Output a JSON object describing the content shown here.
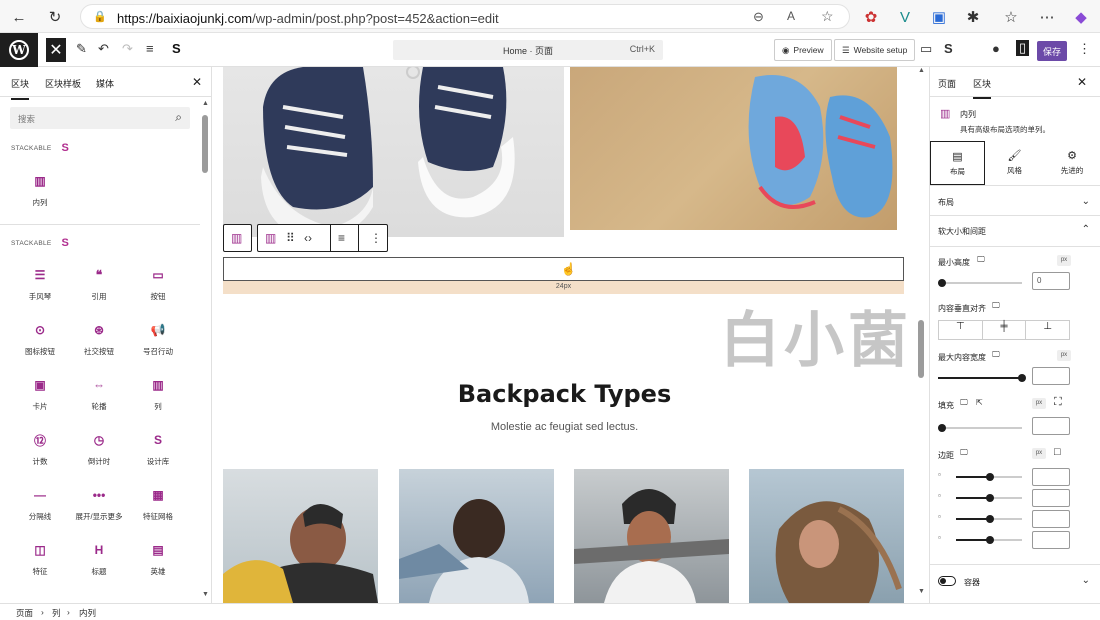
{
  "browser": {
    "url_host": "https://baixiaojunkj.com",
    "url_path": "/wp-admin/post.php?post=452&action=edit"
  },
  "wp_top": {
    "command_label": "Home · 页面",
    "command_shortcut": "Ctrl+K",
    "preview_label": "Preview",
    "website_setup_label": "Website setup",
    "save_label": "保存"
  },
  "left_panel": {
    "tabs": [
      "区块",
      "区块样板",
      "媒体"
    ],
    "search_placeholder": "搜索",
    "category1": "STACKABLE",
    "category1_blocks": [
      {
        "label": "内列",
        "icon": "columns-icon"
      }
    ],
    "category2": "STACKABLE",
    "blocks": [
      {
        "label": "手风琴",
        "icon": "accordion-icon"
      },
      {
        "label": "引用",
        "icon": "quote-icon"
      },
      {
        "label": "按钮",
        "icon": "button-icon"
      },
      {
        "label": "图标按钮",
        "icon": "icon-button-icon"
      },
      {
        "label": "社交按钮",
        "icon": "social-buttons-icon"
      },
      {
        "label": "号召行动",
        "icon": "call-to-action-icon"
      },
      {
        "label": "卡片",
        "icon": "card-icon"
      },
      {
        "label": "轮播",
        "icon": "carousel-icon"
      },
      {
        "label": "列",
        "icon": "column-icon"
      },
      {
        "label": "计数",
        "icon": "count-up-icon"
      },
      {
        "label": "倒计时",
        "icon": "countdown-icon"
      },
      {
        "label": "设计库",
        "icon": "design-library-icon"
      },
      {
        "label": "分隔线",
        "icon": "divider-icon"
      },
      {
        "label": "展开/显示更多",
        "icon": "expand-icon"
      },
      {
        "label": "特征网格",
        "icon": "feature-grid-icon"
      },
      {
        "label": "特征",
        "icon": "feature-icon"
      },
      {
        "label": "标题",
        "icon": "heading-icon"
      },
      {
        "label": "英雄",
        "icon": "hero-icon"
      }
    ]
  },
  "canvas": {
    "spacer_label": "24px",
    "watermark": "白小菌",
    "heading": "Backpack Types",
    "subheading": "Molestie ac feugiat sed lectus."
  },
  "right_panel": {
    "tabs": [
      "页面",
      "区块"
    ],
    "block_name": "内列",
    "block_desc": "具有高级布局选项的单列。",
    "subtabs": [
      "布局",
      "风格",
      "先进的"
    ],
    "section_layout": "布局",
    "section_size": "软大小和间距",
    "min_height_label": "最小高度",
    "min_height_value": "0",
    "unit_px": "px",
    "vertical_align_label": "内容垂直对齐",
    "max_width_label": "最大内容宽度",
    "padding_label": "填充",
    "margin_label": "边距",
    "section_container": "容器"
  },
  "status_bar": {
    "crumbs": [
      "页面",
      "列",
      "内列"
    ]
  },
  "colors": {
    "accent": "#6c4aa8",
    "stackable_pink": "#b02c8e"
  }
}
